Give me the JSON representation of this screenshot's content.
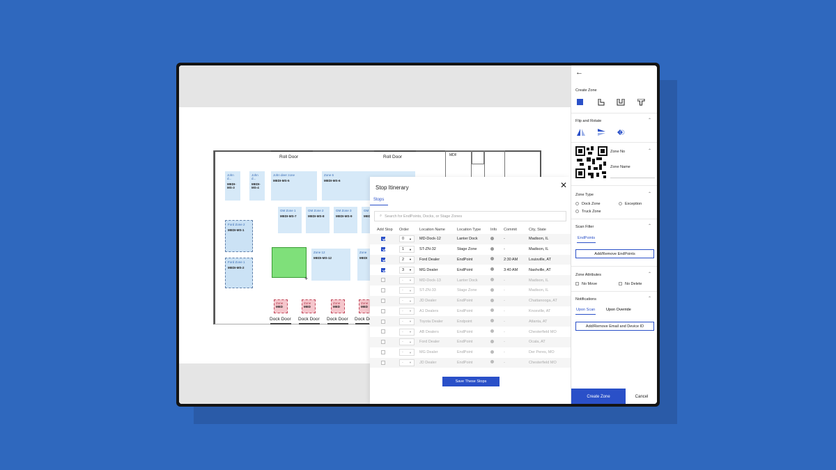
{
  "map": {
    "roll_doors": [
      "Roll Door",
      "Roll Door"
    ],
    "mdf_label": "MDF",
    "zones": [
      {
        "name": "John d...",
        "id": "MEDI-MS-3"
      },
      {
        "name": "John d...",
        "id": "MEDI-MS-4"
      },
      {
        "name": "John deer zone",
        "id": "MEDI-MS-5"
      },
      {
        "name": "Zone 6",
        "id": "MEDI-MS-6"
      },
      {
        "name": "Ford Zone 2",
        "id": "MEDI-MS-1"
      },
      {
        "name": "Ford Zone 1",
        "id": "MEDI-MS-2"
      },
      {
        "name": "GM Zone 1",
        "id": "MEDI-MS-7"
      },
      {
        "name": "GM Zone 2",
        "id": "MEDI-MS-8"
      },
      {
        "name": "GM Zone 3",
        "id": "MEDI-MS-9"
      },
      {
        "name": "GM",
        "id": "MEDI"
      },
      {
        "name": "Zone 12",
        "id": "MEDI-MS-12"
      },
      {
        "name": "Zone",
        "id": "MEDI"
      }
    ],
    "dock_zones": [
      {
        "name": "Zone",
        "id": "MED"
      },
      {
        "name": "Zone",
        "id": "MED"
      },
      {
        "name": "Zone",
        "id": "MED"
      },
      {
        "name": "Zone",
        "id": "MED"
      }
    ],
    "dock_labels": [
      "Dock Door",
      "Dock Door",
      "Dock Door",
      "Dock Door"
    ]
  },
  "modal": {
    "title": "Stop Itinerary",
    "close_icon": "close-icon",
    "tab": "Stops",
    "search_placeholder": "Search for EndPoints, Docks, or Stage Zones",
    "columns": [
      "Add Stop",
      "Order",
      "Location Name",
      "Location Type",
      "Info",
      "Commit",
      "City, State"
    ],
    "rows": [
      {
        "checked": true,
        "order": "0",
        "name": "MD-Dock-12",
        "type": "Lanter Dock",
        "commit": "-",
        "city": "Madison, IL"
      },
      {
        "checked": true,
        "order": "1",
        "name": "ST-ZN-32",
        "type": "Stage Zone",
        "commit": "-",
        "city": "Madison, IL"
      },
      {
        "checked": true,
        "order": "2",
        "name": "Ford Dealer",
        "type": "EndPoint",
        "commit": "2:30 AM",
        "city": "Louisville, AT"
      },
      {
        "checked": true,
        "order": "3",
        "name": "MG Dealer",
        "type": "EndPoint",
        "commit": "3:40 AM",
        "city": "Nashville, AT"
      },
      {
        "checked": false,
        "order": "-",
        "name": "MD-Dock-13",
        "type": "Lanter Dock",
        "commit": "-",
        "city": "Madison, IL"
      },
      {
        "checked": false,
        "order": "-",
        "name": "ST-ZN-33",
        "type": "Stage Zone",
        "commit": "-",
        "city": "Madison, IL"
      },
      {
        "checked": false,
        "order": "-",
        "name": "JD Dealer",
        "type": "EndPoint",
        "commit": "-",
        "city": "Chattanooga, AT"
      },
      {
        "checked": false,
        "order": "-",
        "name": "A1 Dealers",
        "type": "EndPoint",
        "commit": "-",
        "city": "Knoxville, AT"
      },
      {
        "checked": false,
        "order": "-",
        "name": "Toyota Dealer",
        "type": "Endpoint",
        "commit": "-",
        "city": "Atlanta, AT"
      },
      {
        "checked": false,
        "order": "-",
        "name": "AB Dealers",
        "type": "EndPoint",
        "commit": "-",
        "city": "Chesterfield MO"
      },
      {
        "checked": false,
        "order": "-",
        "name": "Ford Dealer",
        "type": "EndPoint",
        "commit": "-",
        "city": "Ocala, AT"
      },
      {
        "checked": false,
        "order": "-",
        "name": "MG Dealer",
        "type": "EndPoint",
        "commit": "-",
        "city": "Der Peres, MO"
      },
      {
        "checked": false,
        "order": "-",
        "name": "JD Dealer",
        "type": "EndPoint",
        "commit": "-",
        "city": "Chesterfield MO"
      }
    ],
    "save_button": "Save These Stops"
  },
  "panel": {
    "back_icon": "arrow-left-icon",
    "create_zone_label": "Create Zone",
    "flip_rotate_label": "Flip and Rotate",
    "zone_no_label": "Zone No",
    "zone_name_label": "Zone Name",
    "zone_type_label": "Zone Type",
    "zone_types": [
      "Dock Zone",
      "Exception",
      "Truck Zone"
    ],
    "scan_filter_label": "Scan Filter",
    "scan_filter_tab": "EndPoints",
    "add_remove_endpoints": "Add/Remove EndPoints",
    "zone_attributes_label": "Zone Attributes",
    "attributes": [
      "No Move",
      "No Delete"
    ],
    "notifications_label": "Notifications",
    "notification_tabs": [
      "Upon Scan",
      "Upon Override"
    ],
    "add_remove_email": "Add/Remove Email and Device ID",
    "create_button": "Create Zone",
    "cancel_button": "Cancel"
  },
  "colors": {
    "background": "#2f68be",
    "accent": "#2a50c8",
    "zone_fill": "#d6e9f8",
    "selected_zone": "#7fe07a",
    "dock_zone": "#f5c6cc"
  }
}
